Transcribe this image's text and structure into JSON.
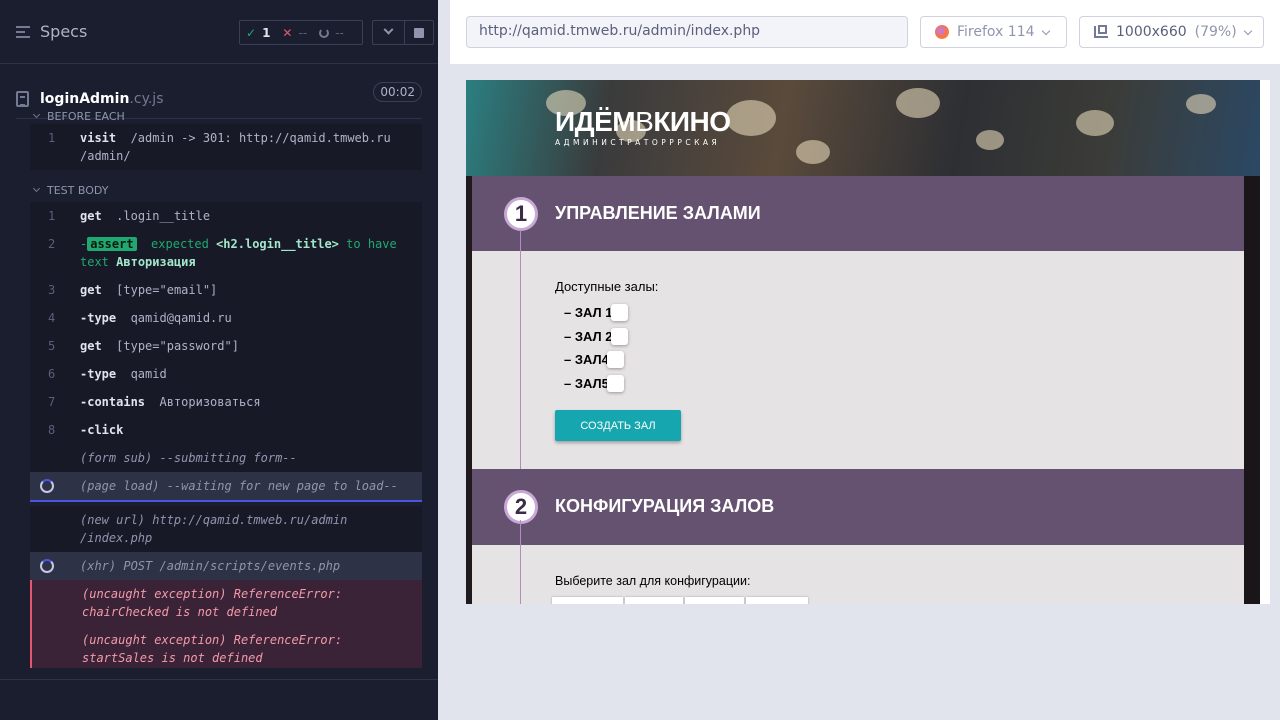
{
  "reporter": {
    "specs_label": "Specs",
    "stats": {
      "passed": "1",
      "failed": "--",
      "pending": "--"
    },
    "spec_file": {
      "name": "loginAdmin",
      "ext": ".cy.js",
      "duration": "00:02"
    },
    "before_each": {
      "title": "BEFORE EACH",
      "commands": [
        {
          "num": "1",
          "name": "visit",
          "message": "/admin -> 301: http://qamid.tmweb.ru /admin/"
        }
      ]
    },
    "test_body": {
      "title": "TEST BODY",
      "commands": [
        {
          "num": "1",
          "name": "get",
          "message": ".login__title"
        },
        {
          "num": "2",
          "name": "assert",
          "message_pre": "expected",
          "message_hl1": "<h2.login__title>",
          "message_mid": "to have text",
          "message_hl2": "Авторизация"
        },
        {
          "num": "3",
          "name": "get",
          "message": "[type=\"email\"]"
        },
        {
          "num": "4",
          "name": "-type",
          "message": "qamid@qamid.ru"
        },
        {
          "num": "5",
          "name": "get",
          "message": "[type=\"password\"]"
        },
        {
          "num": "6",
          "name": "-type",
          "message": "qamid"
        },
        {
          "num": "7",
          "name": "-contains",
          "message": "Авторизоваться"
        },
        {
          "num": "8",
          "name": "-click",
          "message": ""
        }
      ],
      "events": [
        {
          "text": "(form sub)  --submitting form--"
        },
        {
          "text": "(page load)  --waiting for new page to load--"
        },
        {
          "text": "(new url)  http://qamid.tmweb.ru/admin /index.php"
        },
        {
          "text": "(xhr)    POST /admin/scripts/events.php"
        }
      ],
      "errors": [
        {
          "text": "(uncaught exception)  ReferenceError: chairChecked is not defined"
        },
        {
          "text": "(uncaught exception)  ReferenceError: startSales is not defined"
        }
      ]
    }
  },
  "aut": {
    "url": "http://qamid.tmweb.ru/admin/index.php",
    "browser": "Firefox 114",
    "viewport": "1000x660",
    "scale": "(79%)",
    "app": {
      "logo_bold1": "ИДЁМ",
      "logo_thin": "В",
      "logo_bold2": "КИНО",
      "logo_sub": "Администраторррская",
      "section1": {
        "num": "1",
        "title": "УПРАВЛЕНИЕ ЗАЛАМИ"
      },
      "halls_label": "Доступные залы:",
      "halls": [
        "– ЗАЛ 1",
        "– ЗАЛ 2",
        "– ЗАЛ4",
        "– ЗАЛ5"
      ],
      "create_button": "СОЗДАТЬ ЗАЛ",
      "section2": {
        "num": "2",
        "title": "КОНФИГУРАЦИЯ ЗАЛОВ"
      },
      "config_label": "Выберите зал для конфигурации:"
    }
  },
  "colors": {
    "reporter_bg": "#1b1e2e",
    "pass": "#1fa971",
    "fail": "#e45770",
    "active_blue": "#4956e3",
    "section_head": "#645270",
    "create_button": "#16a6af"
  },
  "icons": [
    "specs-icon",
    "check-icon",
    "x-icon",
    "pending-icon",
    "chevron-down-icon",
    "stop-icon",
    "file-icon",
    "spinner-icon",
    "firefox-icon",
    "viewport-icon"
  ]
}
